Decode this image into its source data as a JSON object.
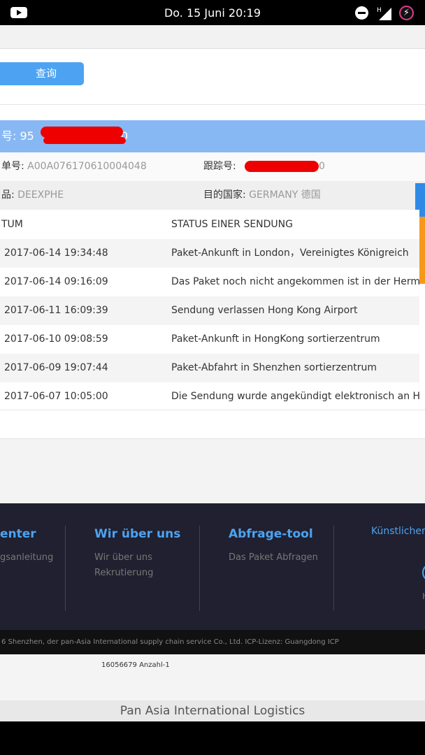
{
  "status_bar": {
    "clock": "Do. 15 Juni 20:19",
    "network_label": "H",
    "icons": [
      "youtube-icon",
      "dnd-icon",
      "signal-icon",
      "battery-charging-icon"
    ]
  },
  "search": {
    "query_button": "查询"
  },
  "result": {
    "tracking_prefix": "号: 95",
    "tracking_suffix": "0",
    "order_label": "单号:",
    "order_value": "A00A076170610004048",
    "track_label": "跟踪号:",
    "track_suffix": "0",
    "product_label": "品:",
    "product_value": "DEEXPHE",
    "country_label": "目的国家:",
    "country_value": "GERMANY 德国"
  },
  "table": {
    "headers": [
      "TUM",
      "STATUS EINER SENDUNG"
    ],
    "rows": [
      {
        "date": "2017-06-14 19:34:48",
        "status": "Paket-Ankunft in London，Vereinigtes Königreich"
      },
      {
        "date": "2017-06-14 09:16:09",
        "status": "Das Paket noch nicht angekommen ist in der Hermes d"
      },
      {
        "date": "2017-06-11 16:09:39",
        "status": "Sendung verlassen Hong Kong Airport"
      },
      {
        "date": "2017-06-10 09:08:59",
        "status": "Paket-Ankunft in HongKong sortierzentrum"
      },
      {
        "date": "2017-06-09 19:07:44",
        "status": "Paket-Abfahrt in Shenzhen sortierzentrum"
      },
      {
        "date": "2017-06-07 10:05:00",
        "status": "Die Sendung wurde angekündigt elektronisch an Hermes"
      }
    ]
  },
  "footer": {
    "col1": {
      "title": "enter",
      "links": [
        "gsanleitung"
      ]
    },
    "col2": {
      "title": "Wir über uns",
      "links": [
        "Wir über uns",
        "Rekrutierung"
      ]
    },
    "col3": {
      "title": "Abfrage-tool",
      "links": [
        "Das Paket Abfragen"
      ]
    },
    "col4": {
      "title": "Künstlichen",
      "char": "H"
    },
    "copyright": "6 Shenzhen, der pan-Asia International supply chain service Co., Ltd. ICP-Lizenz: Guangdong ICP",
    "visits": "16056679 Anzahl-1",
    "brand": "Pan Asia International Logistics"
  },
  "colors": {
    "accent": "#4da3f1",
    "result_bar": "#88b8f4",
    "footer_bg": "#202030",
    "redaction": "#ee0000",
    "side_tab_blue": "#2f8ae6",
    "side_tab_orange": "#f7981d"
  }
}
